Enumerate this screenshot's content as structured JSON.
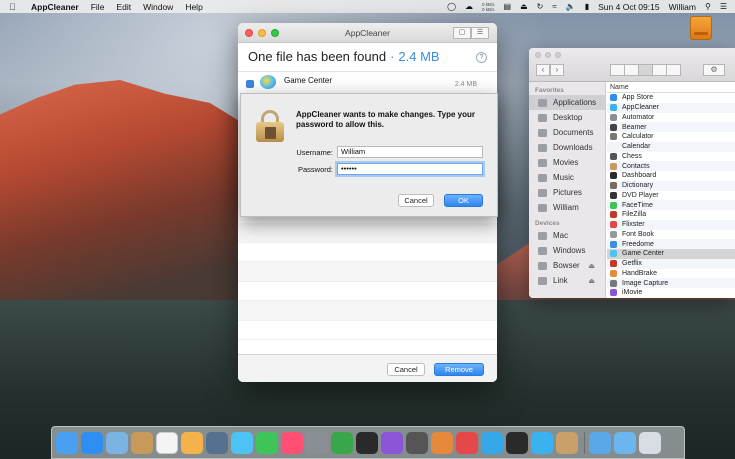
{
  "menubar": {
    "app_name": "AppCleaner",
    "menus": [
      "File",
      "Edit",
      "Window",
      "Help"
    ],
    "netstat_up": "0 kB/s",
    "netstat_down": "0 kB/s",
    "datetime": "Sun 4 Oct  09:15",
    "user": "William"
  },
  "appcleaner": {
    "title": "AppCleaner",
    "found_text": "One file has been found",
    "separator": "·",
    "total_size": "2.4 MB",
    "help": "?",
    "item_name": "Game Center",
    "item_size": "2.4 MB",
    "cancel_label": "Cancel",
    "remove_label": "Remove"
  },
  "auth_dialog": {
    "message": "AppCleaner wants to make changes. Type your password to allow this.",
    "username_label": "Username:",
    "username_value": "William",
    "password_label": "Password:",
    "password_value": "••••••",
    "cancel_label": "Cancel",
    "ok_label": "OK"
  },
  "finder": {
    "column_header": "Name",
    "favorites_header": "Favorites",
    "favorites": [
      "Applications",
      "Desktop",
      "Documents",
      "Downloads",
      "Movies",
      "Music",
      "Pictures",
      "William"
    ],
    "devices_header": "Devices",
    "devices": [
      "Mac",
      "Windows",
      "Bowser",
      "Link"
    ],
    "files": [
      "App Store",
      "AppCleaner",
      "Automator",
      "Beamer",
      "Calculator",
      "Calendar",
      "Chess",
      "Contacts",
      "Dashboard",
      "Dictionary",
      "DVD Player",
      "FaceTime",
      "FileZilla",
      "Flixster",
      "Font Book",
      "Freedome",
      "Game Center",
      "Getflix",
      "HandBrake",
      "Image Capture",
      "iMovie"
    ],
    "highlighted_file": "Game Center"
  },
  "dock": {
    "apps": [
      "finder-icon",
      "safari-icon",
      "preview-icon",
      "notes-icon",
      "calendar-icon",
      "photos-icon",
      "photo-browser-icon",
      "messages-icon",
      "facetime-icon",
      "music-icon",
      "system-preferences-icon",
      "numbers-icon",
      "stocks-icon",
      "imovie-icon",
      "claquette-icon",
      "handbrake-icon",
      "popcorn-icon",
      "airdrop-icon",
      "network-icon",
      "appcleaner-icon",
      "package-icon"
    ],
    "app_colors": [
      "#4aa0f0",
      "#2d8ff2",
      "#7bb4e3",
      "#c79a5a",
      "#f4f4f4",
      "#f3b24a",
      "#56718f",
      "#4cc3f4",
      "#3fc45a",
      "#ff4f72",
      "#8a8f96",
      "#3aa64a",
      "#2a2a2a",
      "#8a55d8",
      "#555555",
      "#e58a3a",
      "#e44848",
      "#35a8e8",
      "#2a2a2a",
      "#3ab2ef",
      "#c9a06a"
    ],
    "right_items": [
      "applications-folder-icon",
      "downloads-folder-icon",
      "trash-icon"
    ]
  }
}
